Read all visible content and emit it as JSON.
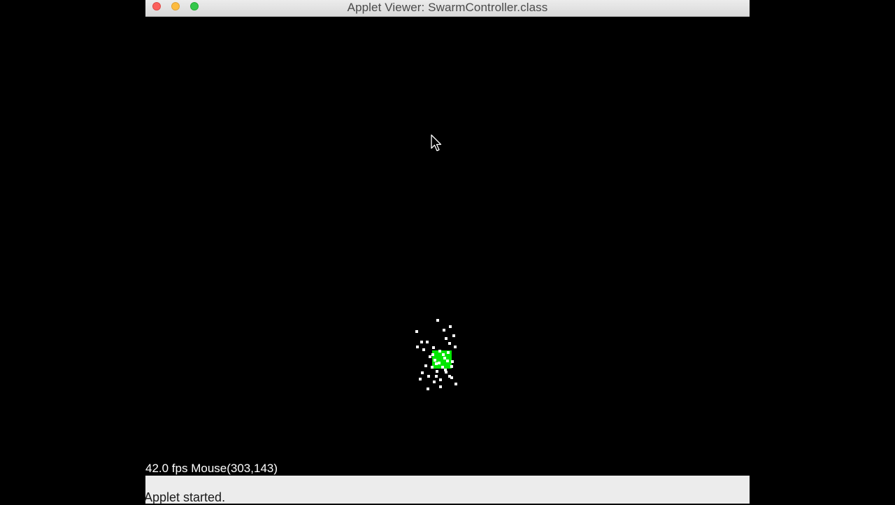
{
  "window": {
    "title": "Applet Viewer: SwarmController.class"
  },
  "hud": {
    "fps_mouse_text": "42.0 fps Mouse(303,143)"
  },
  "statusbar": {
    "text": "Applet started."
  },
  "colors": {
    "leader": "#00e600",
    "particle": "#ffffff",
    "background": "#000000"
  },
  "swarm": {
    "particle_count": 42
  }
}
